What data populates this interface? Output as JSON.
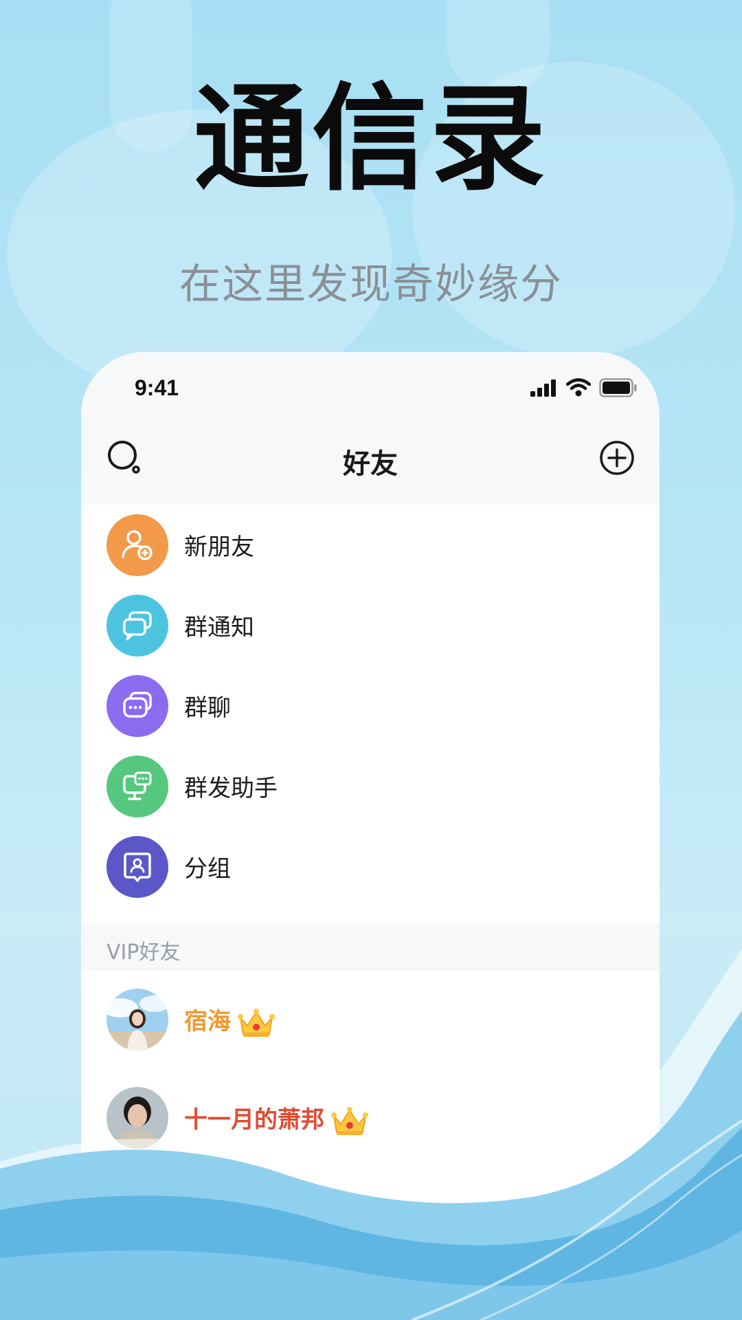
{
  "hero": {
    "title": "通信录",
    "subtitle": "在这里发现奇妙缘分"
  },
  "status_bar": {
    "time": "9:41",
    "icons": [
      "signal-icon",
      "wifi-icon",
      "battery-icon"
    ]
  },
  "nav": {
    "title": "好友",
    "left_icon": "search-icon",
    "right_icon": "add-circle-icon"
  },
  "menu": [
    {
      "label": "新朋友",
      "icon": "add-friend-icon",
      "color": "#f2994a"
    },
    {
      "label": "群通知",
      "icon": "chat-bubbles-icon",
      "color": "#4cc4e0"
    },
    {
      "label": "群聊",
      "icon": "group-chat-icon",
      "color": "#8b6cf0"
    },
    {
      "label": "群发助手",
      "icon": "broadcast-monitor-icon",
      "color": "#55c77f"
    },
    {
      "label": "分组",
      "icon": "contact-card-icon",
      "color": "#5b57c9"
    }
  ],
  "vip_section": {
    "header": "VIP好友",
    "friends": [
      {
        "name": "宿海",
        "name_color": "#f0992b",
        "badge": "crown-icon"
      },
      {
        "name": "十一月的萧邦",
        "name_color": "#e24a32",
        "badge": "crown-icon"
      }
    ]
  }
}
